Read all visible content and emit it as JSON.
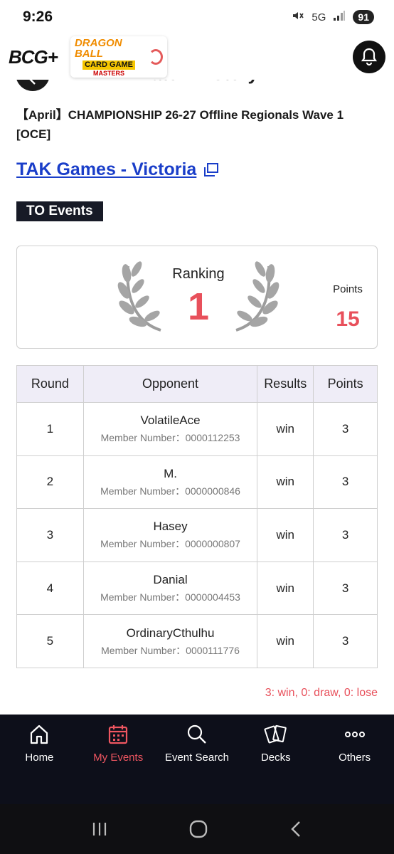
{
  "status_bar": {
    "time": "9:26",
    "network": "5G",
    "battery": "91"
  },
  "header": {
    "brand": "BCG+",
    "logo_line1": "DRAGON BALL",
    "logo_line2": "CARD GAME",
    "logo_line3": "MASTERS"
  },
  "page": {
    "title": "Match History",
    "event_title": "【April】CHAMPIONSHIP 26-27 Offline Regionals Wave 1 [OCE]",
    "venue": "TAK Games - Victoria",
    "badge": "TO Events"
  },
  "ranking": {
    "label": "Ranking",
    "value": "1",
    "points_label": "Points",
    "points_value": "15"
  },
  "table": {
    "headers": [
      "Round",
      "Opponent",
      "Results",
      "Points"
    ],
    "rows": [
      {
        "round": "1",
        "opponent": "VolatileAce",
        "member": "Member Number：0000112253",
        "result": "win",
        "points": "3"
      },
      {
        "round": "2",
        "opponent": "M.",
        "member": "Member Number：0000000846",
        "result": "win",
        "points": "3"
      },
      {
        "round": "3",
        "opponent": "Hasey",
        "member": "Member Number：0000000807",
        "result": "win",
        "points": "3"
      },
      {
        "round": "4",
        "opponent": "Danial",
        "member": "Member Number：0000004453",
        "result": "win",
        "points": "3"
      },
      {
        "round": "5",
        "opponent": "OrdinaryCthulhu",
        "member": "Member Number：0000111776",
        "result": "win",
        "points": "3"
      }
    ],
    "legend": "3: win, 0: draw, 0: lose"
  },
  "nav": [
    {
      "label": "Home",
      "icon": "home-icon"
    },
    {
      "label": "My Events",
      "icon": "calendar-icon"
    },
    {
      "label": "Event Search",
      "icon": "search-icon"
    },
    {
      "label": "Decks",
      "icon": "cards-icon"
    },
    {
      "label": "Others",
      "icon": "more-icon"
    }
  ],
  "colors": {
    "accent": "#e8505b",
    "nav_bg": "#0d0f1a",
    "link": "#1a3ec9"
  }
}
